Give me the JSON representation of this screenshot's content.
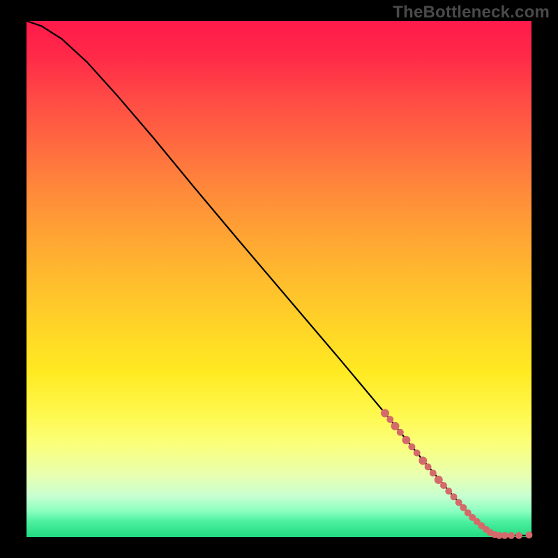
{
  "watermark": "TheBottleneck.com",
  "chart_data": {
    "type": "line",
    "title": "",
    "xlabel": "",
    "ylabel": "",
    "xlim": [
      0,
      100
    ],
    "ylim": [
      0,
      100
    ],
    "grid": false,
    "legend": false,
    "series": [
      {
        "name": "curve",
        "style": "line",
        "color": "#000000",
        "points": [
          {
            "x": 0.0,
            "y": 100.0
          },
          {
            "x": 3.0,
            "y": 99.0
          },
          {
            "x": 7.0,
            "y": 96.5
          },
          {
            "x": 12.0,
            "y": 92.0
          },
          {
            "x": 18.0,
            "y": 85.5
          },
          {
            "x": 25.0,
            "y": 77.5
          },
          {
            "x": 33.0,
            "y": 68.0
          },
          {
            "x": 42.0,
            "y": 57.5
          },
          {
            "x": 52.0,
            "y": 46.0
          },
          {
            "x": 62.0,
            "y": 34.5
          },
          {
            "x": 71.0,
            "y": 24.0
          },
          {
            "x": 78.0,
            "y": 15.5
          },
          {
            "x": 84.0,
            "y": 8.5
          },
          {
            "x": 88.5,
            "y": 3.5
          },
          {
            "x": 91.5,
            "y": 1.0
          },
          {
            "x": 94.0,
            "y": 0.4
          },
          {
            "x": 97.0,
            "y": 0.3
          },
          {
            "x": 100.0,
            "y": 0.3
          }
        ]
      },
      {
        "name": "markers",
        "style": "scatter",
        "color": "#d46a6a",
        "points": [
          {
            "x": 71.0,
            "y": 24.0,
            "r": 6
          },
          {
            "x": 72.0,
            "y": 22.8,
            "r": 5
          },
          {
            "x": 73.0,
            "y": 21.5,
            "r": 6
          },
          {
            "x": 74.0,
            "y": 20.3,
            "r": 5
          },
          {
            "x": 75.2,
            "y": 18.8,
            "r": 6
          },
          {
            "x": 76.3,
            "y": 17.5,
            "r": 5
          },
          {
            "x": 77.3,
            "y": 16.3,
            "r": 5
          },
          {
            "x": 78.5,
            "y": 14.8,
            "r": 6
          },
          {
            "x": 79.5,
            "y": 13.6,
            "r": 5
          },
          {
            "x": 80.5,
            "y": 12.4,
            "r": 5
          },
          {
            "x": 81.6,
            "y": 11.1,
            "r": 6
          },
          {
            "x": 82.6,
            "y": 10.0,
            "r": 5
          },
          {
            "x": 83.6,
            "y": 8.9,
            "r": 5
          },
          {
            "x": 84.6,
            "y": 7.8,
            "r": 5
          },
          {
            "x": 85.6,
            "y": 6.7,
            "r": 5
          },
          {
            "x": 86.5,
            "y": 5.7,
            "r": 5
          },
          {
            "x": 87.4,
            "y": 4.7,
            "r": 5
          },
          {
            "x": 88.3,
            "y": 3.8,
            "r": 5
          },
          {
            "x": 89.2,
            "y": 3.0,
            "r": 5
          },
          {
            "x": 90.1,
            "y": 2.2,
            "r": 5
          },
          {
            "x": 91.0,
            "y": 1.5,
            "r": 5
          },
          {
            "x": 91.8,
            "y": 0.9,
            "r": 5
          },
          {
            "x": 92.7,
            "y": 0.5,
            "r": 5
          },
          {
            "x": 93.6,
            "y": 0.3,
            "r": 5
          },
          {
            "x": 94.7,
            "y": 0.3,
            "r": 5
          },
          {
            "x": 96.0,
            "y": 0.3,
            "r": 5
          },
          {
            "x": 97.5,
            "y": 0.3,
            "r": 5
          },
          {
            "x": 99.5,
            "y": 0.4,
            "r": 5
          }
        ]
      }
    ]
  }
}
